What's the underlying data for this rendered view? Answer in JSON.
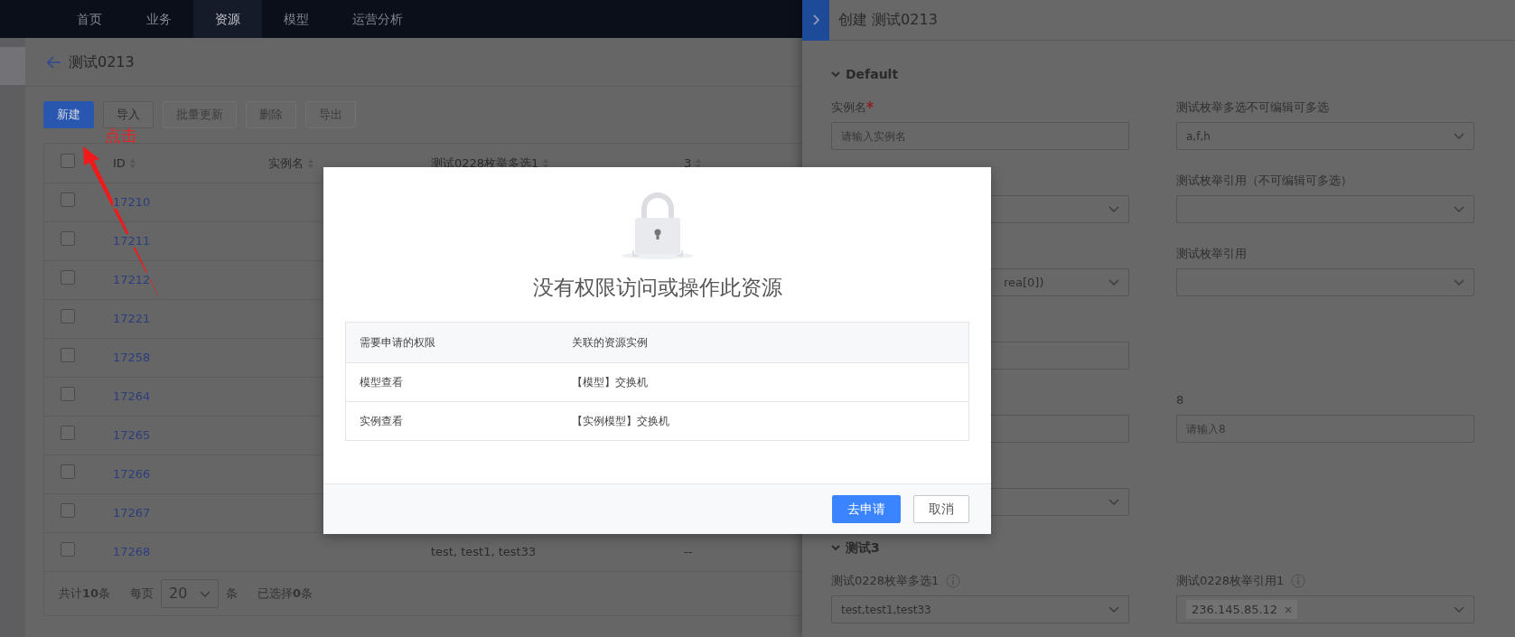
{
  "nav": {
    "items": [
      {
        "label": "首页",
        "selected": false
      },
      {
        "label": "业务",
        "selected": false
      },
      {
        "label": "资源",
        "selected": true
      },
      {
        "label": "模型",
        "selected": false
      },
      {
        "label": "运营分析",
        "selected": false
      }
    ]
  },
  "page": {
    "title": "测试0213"
  },
  "toolbar": {
    "buttons": [
      {
        "label": "新建",
        "kind": "primary",
        "disabled": false
      },
      {
        "label": "导入",
        "kind": "default",
        "disabled": false
      },
      {
        "label": "批量更新",
        "kind": "default",
        "disabled": true
      },
      {
        "label": "删除",
        "kind": "default",
        "disabled": true
      },
      {
        "label": "导出",
        "kind": "default",
        "disabled": true
      }
    ]
  },
  "annotation": {
    "text": "点击"
  },
  "table": {
    "select_all_checked": false,
    "columns": [
      {
        "label": "ID",
        "sortable": true
      },
      {
        "label": "实例名",
        "sortable": true
      },
      {
        "label": "测试0228枚举多选1",
        "sortable": true
      },
      {
        "label": "3",
        "sortable": true
      }
    ],
    "rows": [
      {
        "id": "17210",
        "checked": false
      },
      {
        "id": "17211",
        "checked": false
      },
      {
        "id": "17212",
        "checked": false
      },
      {
        "id": "17221",
        "checked": false
      },
      {
        "id": "17258",
        "checked": false
      },
      {
        "id": "17264",
        "checked": false
      },
      {
        "id": "17265",
        "checked": false
      },
      {
        "id": "17266",
        "checked": false
      },
      {
        "id": "17267",
        "checked": false
      },
      {
        "id": "17268",
        "checked": false,
        "column_3": "test, test1, test33",
        "column_4": "--"
      }
    ]
  },
  "pagination": {
    "total": "共计**10**条",
    "per_page_label": "每页",
    "per_page": "20",
    "unit": "条",
    "selected": "已选择**0**条"
  },
  "drawer": {
    "title": "创建 测试0213",
    "sections": [
      {
        "title": "Default",
        "expanded": true,
        "rows": [
          {
            "left": {
              "kind": "input",
              "label": "实例名",
              "required": true,
              "placeholder": "请输入实例名"
            },
            "right": {
              "kind": "select",
              "label": "测试枚举多选不可编辑可多选",
              "value": "a,f,h"
            }
          },
          {
            "left": {
              "kind": "select"
            },
            "right": {
              "kind": "select",
              "label": "测试枚举引用（不可编辑可多选）"
            }
          },
          {
            "left": {
              "kind": "select",
              "value": "rea[0])"
            },
            "right": {
              "kind": "select",
              "label": "测试枚举引用"
            }
          },
          {
            "left": {
              "kind": "input"
            }
          },
          {
            "left": {
              "kind": "input"
            },
            "right": {
              "kind": "input",
              "label": "8",
              "placeholder": "请输入8"
            }
          },
          {
            "left": {
              "kind": "select"
            }
          }
        ]
      },
      {
        "title": "测试3",
        "expanded": true,
        "rows": [
          {
            "left": {
              "kind": "select",
              "label": "测试0228枚举多选1",
              "info": true,
              "value": "test,test1,test33"
            },
            "right": {
              "kind": "select",
              "label": "测试0228枚举引用1",
              "info": true,
              "tags": [
                "236.145.85.12"
              ]
            }
          }
        ]
      }
    ]
  },
  "modal": {
    "title": "没有权限访问或操作此资源",
    "columns": [
      "需要申请的权限",
      "关联的资源实例"
    ],
    "rows": [
      [
        "模型查看",
        "【模型】交换机"
      ],
      [
        "实例查看",
        "【实例模型】交换机"
      ]
    ],
    "buttons": [
      {
        "label": "去申请",
        "kind": "primary"
      },
      {
        "label": "取消",
        "kind": "default"
      }
    ]
  }
}
